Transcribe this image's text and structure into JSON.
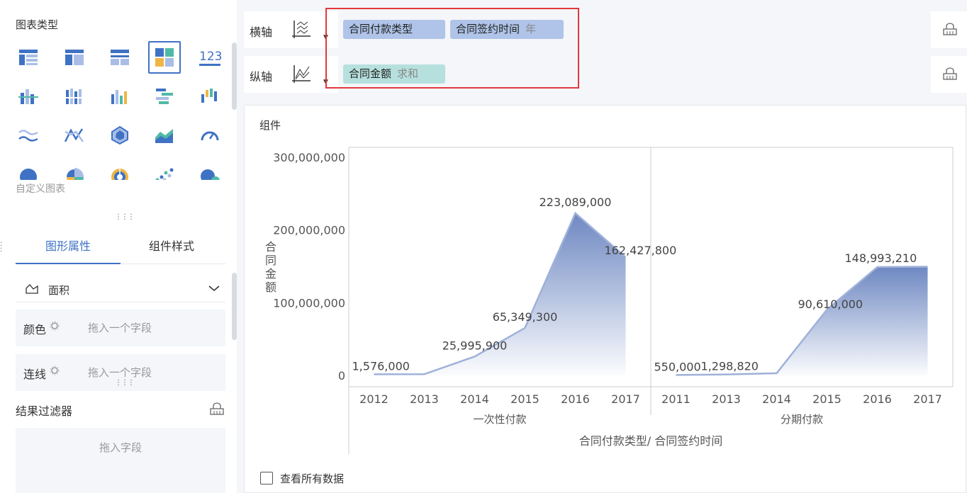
{
  "left_panel": {
    "chart_types_title": "图表类型",
    "chart_type_icons": [
      "table-icon",
      "cross-table-icon",
      "detail-table-icon",
      "dashboard-table-icon",
      "kpi-number-icon",
      "grouped-bar-icon",
      "stacked-bar-icon",
      "multi-series-bar-icon",
      "horizontal-bar-icon",
      "waterfall-icon",
      "line-icon",
      "polyline-icon",
      "radar-icon",
      "area-icon",
      "gauge-icon",
      "pie-icon",
      "rose-pie-icon",
      "sunburst-icon",
      "scatter-icon",
      "bubble-icon"
    ],
    "selected_chart_type_index": 3,
    "kpi_text": "123",
    "custom_chart": "自定义图表",
    "tabs": [
      {
        "label": "图形属性",
        "active": true
      },
      {
        "label": "组件样式",
        "active": false
      }
    ],
    "shape": {
      "icon": "area-shape-icon",
      "label": "面积"
    },
    "fields": [
      {
        "label": "颜色",
        "placeholder": "拖入一个字段"
      },
      {
        "label": "连线",
        "placeholder": "拖入一个字段"
      }
    ],
    "result_filter": {
      "title": "结果过滤器",
      "placeholder": "拖入字段"
    }
  },
  "axes": {
    "x": {
      "label": "横轴",
      "pills": [
        {
          "field": "合同付款类型",
          "agg": ""
        },
        {
          "field": "合同签约时间",
          "agg": "年"
        }
      ]
    },
    "y": {
      "label": "纵轴",
      "pills": [
        {
          "field": "合同金额",
          "agg": "求和"
        }
      ]
    }
  },
  "component": {
    "title": "组件",
    "show_all_data": "查看所有数据"
  },
  "colors": {
    "accent": "#3f72c4",
    "area_top": "#6e88c2",
    "area_line": "#9fb1d9",
    "highlight": "#e0383e",
    "pill_blue": "#afc4e8",
    "pill_teal": "#b6e0dd"
  },
  "chart_data": {
    "type": "area",
    "title": "",
    "ylabel": "合同金额",
    "xlabel": "合同付款类型/ 合同签约时间",
    "ylim": [
      0,
      300000000
    ],
    "y_ticks": [
      "0",
      "100,000,000",
      "200,000,000",
      "300,000,000"
    ],
    "y_tick_values": [
      0,
      100000000,
      200000000,
      300000000
    ],
    "grid": false,
    "panels": [
      {
        "category": "一次性付款",
        "x": [
          "2012",
          "2013",
          "2014",
          "2015",
          "2016",
          "2017"
        ],
        "values": [
          1576000,
          1700000,
          25995900,
          65349300,
          223089000,
          162427800
        ],
        "labels": [
          "1,576,000",
          "",
          "25,995,900",
          "65,349,300",
          "223,089,000",
          "162,427,800"
        ]
      },
      {
        "category": "分期付款",
        "x": [
          "2011",
          "2013",
          "2014",
          "2015",
          "2016",
          "2017"
        ],
        "values": [
          550000,
          1298820,
          3000000,
          90610000,
          148993210,
          149500000
        ],
        "labels": [
          "550,000",
          "1,298,820",
          "",
          "90,610,000",
          "148,993,210",
          ""
        ]
      }
    ]
  }
}
